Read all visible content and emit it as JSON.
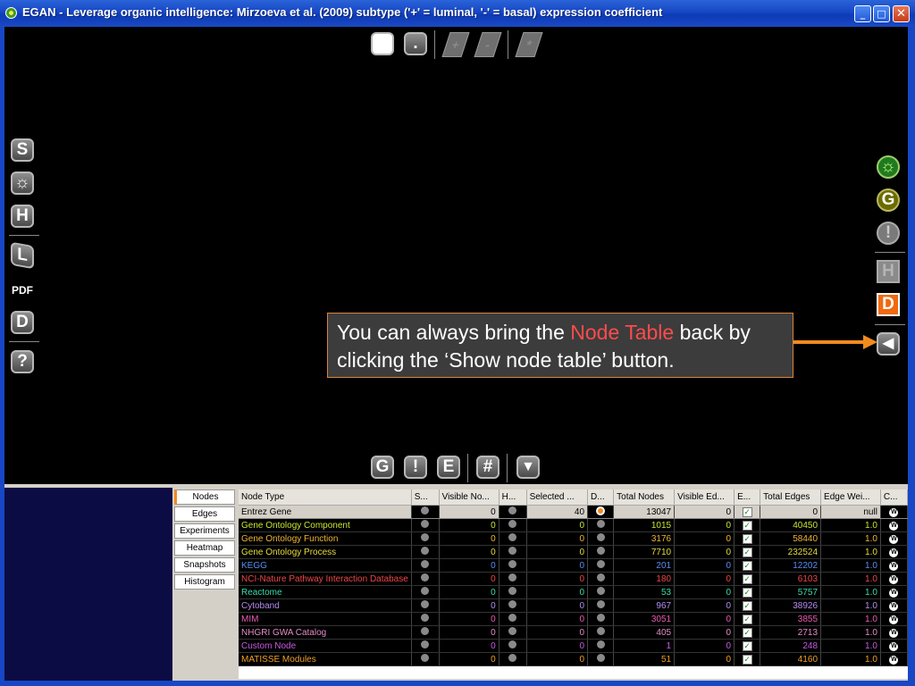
{
  "window": {
    "title": "EGAN - Leverage organic intelligence: Mirzoeva et al. (2009) subtype ('+' = luminal, '-' = basal) expression coefficient",
    "minimize": "_",
    "maximize": "□",
    "close": "✕"
  },
  "top_toolbar": {
    "square_button": "■",
    "dot_button": ".",
    "plus_button": "+",
    "minus_button": "-",
    "star_button": "*"
  },
  "left_toolbar": {
    "s_button": "S",
    "gear_button": "☼",
    "h_button": "H",
    "l_button": "L",
    "pdf_button": "PDF",
    "d_button": "D",
    "help_button": "?"
  },
  "right_toolbar": {
    "gear_button": "☼",
    "g_button": "G",
    "alert_button": "!",
    "h_button": "H",
    "d_button": "D",
    "show_node_table_button": "◀"
  },
  "bottom_toolbar": {
    "g_button": "G",
    "alert_button": "!",
    "e_button": "E",
    "hash_button": "#",
    "down_button": "▼"
  },
  "tooltip": {
    "part1": "You can always bring the ",
    "highlight": "Node Table",
    "part2": " back by clicking the ‘Show node table’ button."
  },
  "tabs": [
    {
      "label": "Nodes"
    },
    {
      "label": "Edges"
    },
    {
      "label": "Experiments"
    },
    {
      "label": "Heatmap"
    },
    {
      "label": "Snapshots"
    },
    {
      "label": "Histogram"
    }
  ],
  "table": {
    "headers": [
      "Node Type",
      "S...",
      "Visible No...",
      "H...",
      "Selected ...",
      "D...",
      "Total Nodes",
      "Visible Ed...",
      "E...",
      "Total Edges",
      "Edge Wei...",
      "C..."
    ],
    "rows": [
      {
        "name": "Entrez Gene",
        "visible": "0",
        "selected": "40",
        "total_nodes": "13047",
        "visible_edges": "0",
        "total_edges": "0",
        "edge_weight": "null",
        "color": "#000000"
      },
      {
        "name": "Gene Ontology Component",
        "visible": "0",
        "selected": "0",
        "total_nodes": "1015",
        "visible_edges": "0",
        "total_edges": "40450",
        "edge_weight": "1.0",
        "color": "#c8e632"
      },
      {
        "name": "Gene Ontology Function",
        "visible": "0",
        "selected": "0",
        "total_nodes": "3176",
        "visible_edges": "0",
        "total_edges": "58440",
        "edge_weight": "1.0",
        "color": "#f0b432"
      },
      {
        "name": "Gene Ontology Process",
        "visible": "0",
        "selected": "0",
        "total_nodes": "7710",
        "visible_edges": "0",
        "total_edges": "232524",
        "edge_weight": "1.0",
        "color": "#e6dc3c"
      },
      {
        "name": "KEGG",
        "visible": "0",
        "selected": "0",
        "total_nodes": "201",
        "visible_edges": "0",
        "total_edges": "12202",
        "edge_weight": "1.0",
        "color": "#5a8cf0"
      },
      {
        "name": "NCI-Nature Pathway Interaction Database",
        "visible": "0",
        "selected": "0",
        "total_nodes": "180",
        "visible_edges": "0",
        "total_edges": "6103",
        "edge_weight": "1.0",
        "color": "#f04646"
      },
      {
        "name": "Reactome",
        "visible": "0",
        "selected": "0",
        "total_nodes": "53",
        "visible_edges": "0",
        "total_edges": "5757",
        "edge_weight": "1.0",
        "color": "#3cdcaa"
      },
      {
        "name": "Cytoband",
        "visible": "0",
        "selected": "0",
        "total_nodes": "967",
        "visible_edges": "0",
        "total_edges": "38926",
        "edge_weight": "1.0",
        "color": "#b48cf0"
      },
      {
        "name": "MIM",
        "visible": "0",
        "selected": "0",
        "total_nodes": "3051",
        "visible_edges": "0",
        "total_edges": "3855",
        "edge_weight": "1.0",
        "color": "#f05ab4"
      },
      {
        "name": "NHGRI GWA Catalog",
        "visible": "0",
        "selected": "0",
        "total_nodes": "405",
        "visible_edges": "0",
        "total_edges": "2713",
        "edge_weight": "1.0",
        "color": "#e68cc8"
      },
      {
        "name": "Custom Node",
        "visible": "0",
        "selected": "0",
        "total_nodes": "1",
        "visible_edges": "0",
        "total_edges": "248",
        "edge_weight": "1.0",
        "color": "#c85ae6"
      },
      {
        "name": "MATISSE Modules",
        "visible": "0",
        "selected": "0",
        "total_nodes": "51",
        "visible_edges": "0",
        "total_edges": "4160",
        "edge_weight": "1.0",
        "color": "#f0a028"
      }
    ],
    "cell_symbols": {
      "checkbox": "✓",
      "color_button": "W"
    }
  }
}
